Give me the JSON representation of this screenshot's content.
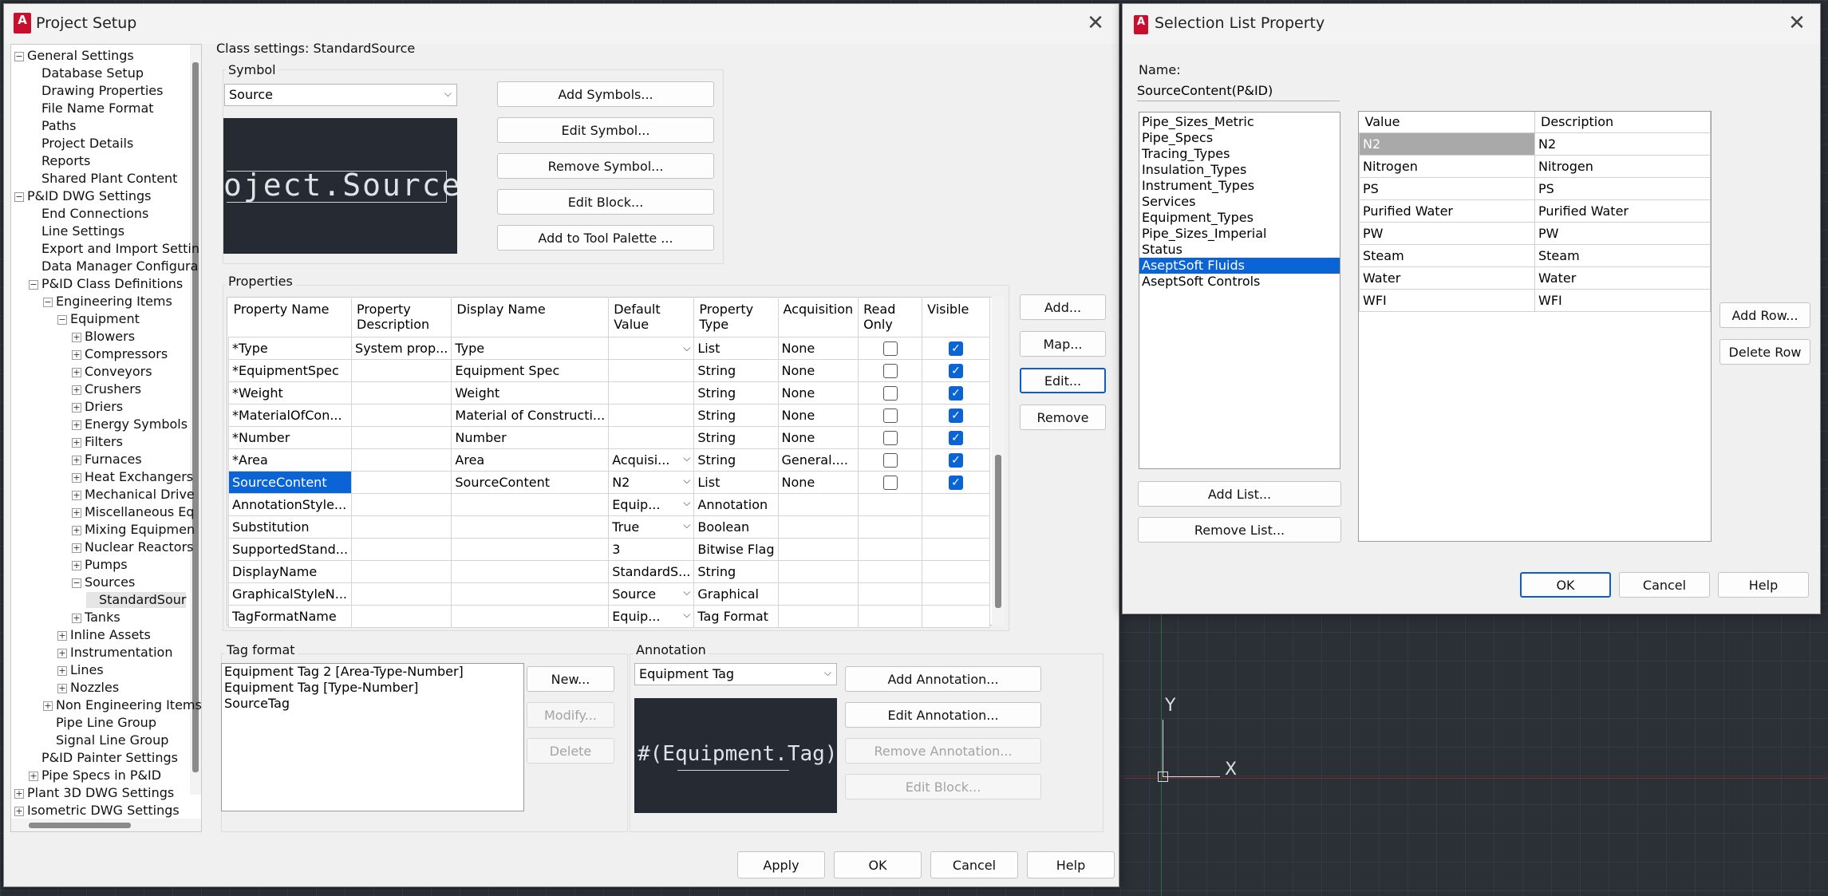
{
  "project_setup": {
    "title": "Project Setup",
    "class_settings": "Class settings: StandardSource",
    "tree": [
      {
        "label": "General Settings",
        "level": 0,
        "toggle": "-"
      },
      {
        "label": "Database Setup",
        "level": 1
      },
      {
        "label": "Drawing Properties",
        "level": 1
      },
      {
        "label": "File Name Format",
        "level": 1
      },
      {
        "label": "Paths",
        "level": 1
      },
      {
        "label": "Project Details",
        "level": 1
      },
      {
        "label": "Reports",
        "level": 1
      },
      {
        "label": "Shared Plant Content",
        "level": 1
      },
      {
        "label": "P&ID DWG Settings",
        "level": 0,
        "toggle": "-"
      },
      {
        "label": "End Connections",
        "level": 1
      },
      {
        "label": "Line Settings",
        "level": 1
      },
      {
        "label": "Export and Import Settin",
        "level": 1
      },
      {
        "label": "Data Manager Configura",
        "level": 1
      },
      {
        "label": "P&ID Class Definitions",
        "level": 1,
        "toggle": "-"
      },
      {
        "label": "Engineering Items",
        "level": 2,
        "toggle": "-"
      },
      {
        "label": "Equipment",
        "level": 3,
        "toggle": "-"
      },
      {
        "label": "Blowers",
        "level": 4,
        "toggle": "+"
      },
      {
        "label": "Compressors",
        "level": 4,
        "toggle": "+"
      },
      {
        "label": "Conveyors",
        "level": 4,
        "toggle": "+"
      },
      {
        "label": "Crushers",
        "level": 4,
        "toggle": "+"
      },
      {
        "label": "Driers",
        "level": 4,
        "toggle": "+"
      },
      {
        "label": "Energy Symbols",
        "level": 4,
        "toggle": "+"
      },
      {
        "label": "Filters",
        "level": 4,
        "toggle": "+"
      },
      {
        "label": "Furnaces",
        "level": 4,
        "toggle": "+"
      },
      {
        "label": "Heat Exchangers",
        "level": 4,
        "toggle": "+"
      },
      {
        "label": "Mechanical Drive",
        "level": 4,
        "toggle": "+"
      },
      {
        "label": "Miscellaneous Eq",
        "level": 4,
        "toggle": "+"
      },
      {
        "label": "Mixing Equipmen",
        "level": 4,
        "toggle": "+"
      },
      {
        "label": "Nuclear Reactors",
        "level": 4,
        "toggle": "+"
      },
      {
        "label": "Pumps",
        "level": 4,
        "toggle": "+"
      },
      {
        "label": "Sources",
        "level": 4,
        "toggle": "-"
      },
      {
        "label": "StandardSour",
        "level": 5,
        "selected": true
      },
      {
        "label": "Tanks",
        "level": 4,
        "toggle": "+"
      },
      {
        "label": "Inline Assets",
        "level": 3,
        "toggle": "+"
      },
      {
        "label": "Instrumentation",
        "level": 3,
        "toggle": "+"
      },
      {
        "label": "Lines",
        "level": 3,
        "toggle": "+"
      },
      {
        "label": "Nozzles",
        "level": 3,
        "toggle": "+"
      },
      {
        "label": "Non Engineering Items",
        "level": 2,
        "toggle": "+"
      },
      {
        "label": "Pipe Line Group",
        "level": 2
      },
      {
        "label": "Signal Line Group",
        "level": 2
      },
      {
        "label": "P&ID Painter Settings",
        "level": 1
      },
      {
        "label": "Pipe Specs in P&ID",
        "level": 1,
        "toggle": "+"
      },
      {
        "label": "Plant 3D DWG Settings",
        "level": 0,
        "toggle": "+"
      },
      {
        "label": "Isometric DWG Settings",
        "level": 0,
        "toggle": "+"
      }
    ],
    "symbol": {
      "group_label": "Symbol",
      "dropdown_value": "Source",
      "preview_text": "oject.Source",
      "buttons": [
        "Add Symbols...",
        "Edit Symbol...",
        "Remove Symbol...",
        "Edit Block...",
        "Add to Tool Palette ..."
      ]
    },
    "properties": {
      "group_label": "Properties",
      "headers": [
        "Property Name",
        "Property Description",
        "Display Name",
        "Default Value",
        "Property Type",
        "Acquisition",
        "Read Only",
        "Visible"
      ],
      "rows": [
        {
          "name": "*Type",
          "desc": "System prop...",
          "display": "Type",
          "default": "",
          "dd": true,
          "type": "List",
          "acq": "None",
          "ro": false,
          "vis": true
        },
        {
          "name": "*EquipmentSpec",
          "desc": "",
          "display": "Equipment Spec",
          "default": "",
          "dd": false,
          "type": "String",
          "acq": "None",
          "ro": false,
          "vis": true
        },
        {
          "name": "*Weight",
          "desc": "",
          "display": "Weight",
          "default": "",
          "dd": false,
          "type": "String",
          "acq": "None",
          "ro": false,
          "vis": true
        },
        {
          "name": "*MaterialOfCon...",
          "desc": "",
          "display": "Material of Constructi...",
          "default": "",
          "dd": false,
          "type": "String",
          "acq": "None",
          "ro": false,
          "vis": true
        },
        {
          "name": "*Number",
          "desc": "",
          "display": "Number",
          "default": "",
          "dd": false,
          "type": "String",
          "acq": "None",
          "ro": false,
          "vis": true
        },
        {
          "name": "*Area",
          "desc": "",
          "display": "Area",
          "default": "Acquisi...",
          "dd": true,
          "type": "String",
          "acq": "General....",
          "ro": false,
          "vis": true
        },
        {
          "name": "SourceContent",
          "desc": "",
          "display": "SourceContent",
          "default": "N2",
          "dd": true,
          "type": "List",
          "acq": "None",
          "ro": false,
          "vis": true,
          "selected": true
        },
        {
          "name": "AnnotationStyle...",
          "desc": "",
          "display": "",
          "default": "Equip...",
          "dd": true,
          "type": "Annotation",
          "acq": "",
          "ro": null,
          "vis": null
        },
        {
          "name": "Substitution",
          "desc": "",
          "display": "",
          "default": "True",
          "dd": true,
          "type": "Boolean",
          "acq": "",
          "ro": null,
          "vis": null
        },
        {
          "name": "SupportedStand...",
          "desc": "",
          "display": "",
          "default": "3",
          "dd": false,
          "type": "Bitwise Flag",
          "acq": "",
          "ro": null,
          "vis": null
        },
        {
          "name": "DisplayName",
          "desc": "",
          "display": "",
          "default": "StandardS...",
          "dd": false,
          "type": "String",
          "acq": "",
          "ro": null,
          "vis": null
        },
        {
          "name": "GraphicalStyleN...",
          "desc": "",
          "display": "",
          "default": "Source",
          "dd": true,
          "type": "Graphical",
          "acq": "",
          "ro": null,
          "vis": null
        },
        {
          "name": "TagFormatName",
          "desc": "",
          "display": "",
          "default": "Equip...",
          "dd": true,
          "type": "Tag Format",
          "acq": "",
          "ro": null,
          "vis": null
        }
      ],
      "side_buttons": [
        "Add...",
        "Map...",
        "Edit...",
        "Remove"
      ]
    },
    "tag_format": {
      "group_label": "Tag format",
      "items": [
        "Equipment Tag 2 [Area-Type-Number]",
        "Equipment Tag [Type-Number]",
        "SourceTag"
      ],
      "buttons": [
        "New...",
        "Modify...",
        "Delete"
      ]
    },
    "annotation": {
      "group_label": "Annotation",
      "dropdown_value": "Equipment Tag",
      "preview_text": "#(Equipment.Tag)",
      "buttons": [
        "Add Annotation...",
        "Edit Annotation...",
        "Remove Annotation...",
        "Edit Block..."
      ]
    },
    "footer_buttons": [
      "Apply",
      "OK",
      "Cancel",
      "Help"
    ]
  },
  "selection_list": {
    "title": "Selection List Property",
    "name_label": "Name:",
    "name_value": "SourceContent(P&ID)",
    "lists": [
      "Pipe_Sizes_Metric",
      "Pipe_Specs",
      "Tracing_Types",
      "Insulation_Types",
      "Instrument_Types",
      "Services",
      "Equipment_Types",
      "Pipe_Sizes_Imperial",
      "Status",
      "AseptSoft Fluids",
      "AseptSoft Controls"
    ],
    "selected_list": "AseptSoft Fluids",
    "list_buttons": [
      "Add List...",
      "Remove List..."
    ],
    "value_headers": [
      "Value",
      "Description"
    ],
    "values": [
      {
        "value": "N2",
        "desc": "N2"
      },
      {
        "value": "Nitrogen",
        "desc": "Nitrogen"
      },
      {
        "value": "PS",
        "desc": "PS"
      },
      {
        "value": "Purified Water",
        "desc": "Purified Water"
      },
      {
        "value": "PW",
        "desc": "PW"
      },
      {
        "value": "Steam",
        "desc": "Steam"
      },
      {
        "value": "Water",
        "desc": "Water"
      },
      {
        "value": "WFI",
        "desc": "WFI"
      }
    ],
    "row_buttons": [
      "Add Row...",
      "Delete Row"
    ],
    "footer_buttons": [
      "OK",
      "Cancel",
      "Help"
    ]
  },
  "canvas": {
    "y_axis_label": "Y",
    "x_axis_label": "X",
    "accent": "#0a64d6",
    "background": "#2b2f36"
  }
}
